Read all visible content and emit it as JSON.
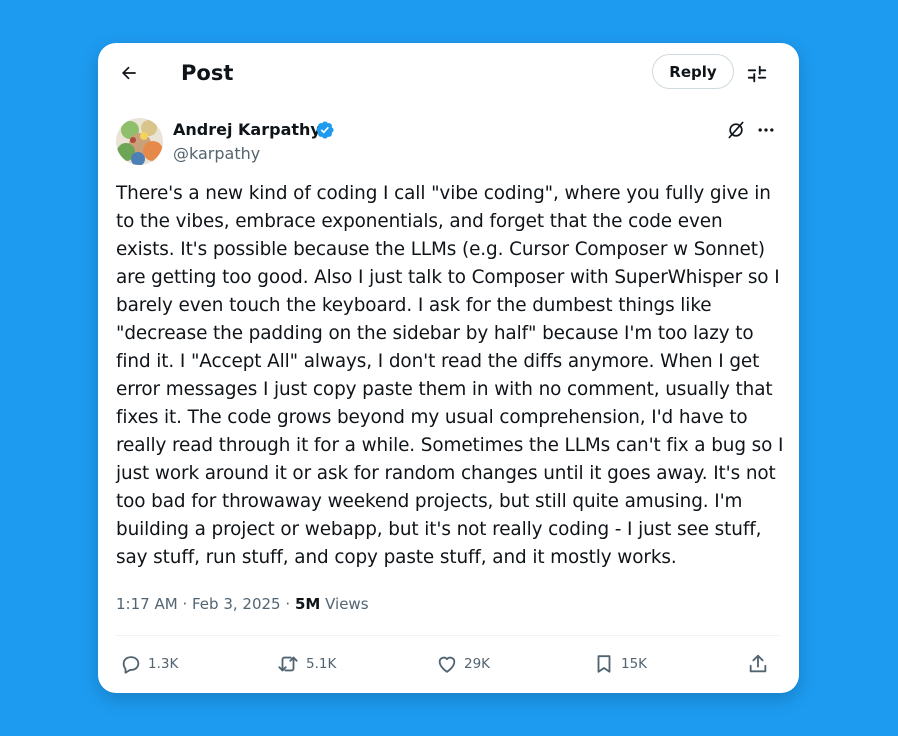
{
  "header": {
    "title": "Post",
    "reply_label": "Reply"
  },
  "author": {
    "name": "Andrej Karpathy",
    "handle": "@karpathy",
    "verified": true
  },
  "post": {
    "text": "There's a new kind of coding I call \"vibe coding\", where you fully give in to the vibes, embrace exponentials, and forget that the code even exists. It's possible because the LLMs (e.g. Cursor Composer w Sonnet) are getting too good. Also I just talk to Composer with SuperWhisper so I barely even touch the keyboard. I ask for the dumbest things like \"decrease the padding on the sidebar by half\" because I'm too lazy to find it. I \"Accept All\" always, I don't read the diffs anymore. When I get error messages I just copy paste them in with no comment, usually that fixes it. The code grows beyond my usual comprehension, I'd have to really read through it for a while. Sometimes the LLMs can't fix a bug so I just work around it or ask for random changes until it goes away. It's not too bad for throwaway weekend projects, but still quite amusing. I'm building a project or webapp, but it's not really coding - I just see stuff, say stuff, run stuff, and copy paste stuff, and it mostly works.",
    "time": "1:17 AM",
    "date": "Feb 3, 2025",
    "separator": "·",
    "views_count": "5M",
    "views_label": "Views"
  },
  "actions": {
    "replies": "1.3K",
    "reposts": "5.1K",
    "likes": "29K",
    "bookmarks": "15K"
  },
  "icons": {
    "back": "arrow-left-icon",
    "settings": "sliders-icon",
    "verified": "verified-badge-icon",
    "grok": "grok-icon",
    "more": "more-horizontal-icon",
    "reply": "comment-icon",
    "repost": "repost-icon",
    "like": "heart-icon",
    "bookmark": "bookmark-icon",
    "share": "share-icon"
  },
  "colors": {
    "background": "#1d9bf0",
    "verified": "#1d9bf0",
    "text": "#0f1419",
    "secondary_text": "#536471"
  }
}
